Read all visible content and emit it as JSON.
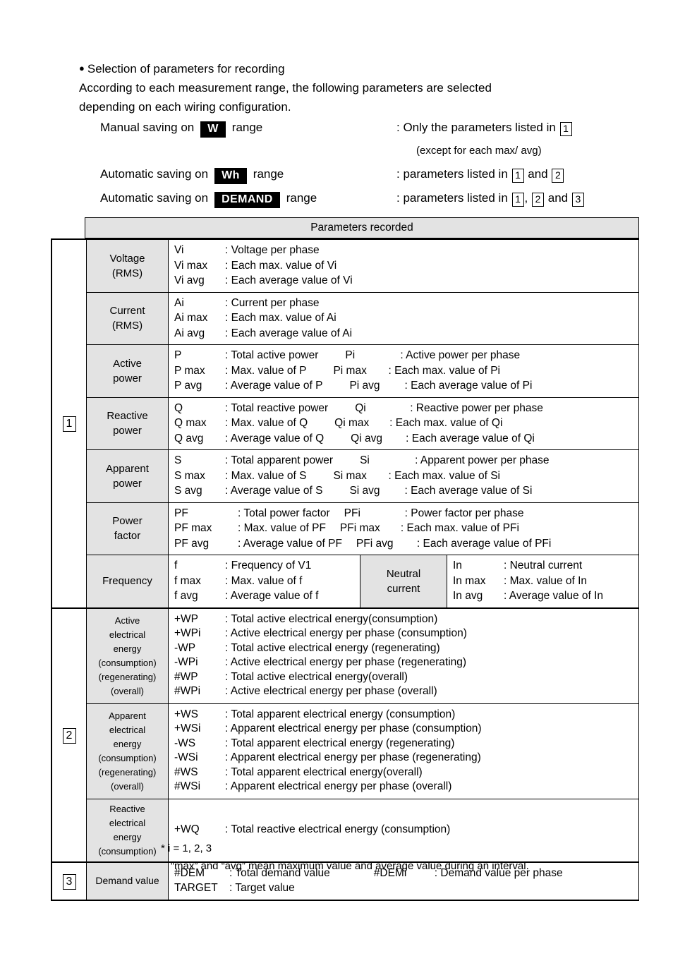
{
  "intro": {
    "bullet": "Selection of parameters for recording",
    "line1": "According to each measurement range, the following parameters are selected",
    "line2": "depending on each wiring configuration.",
    "rows": [
      {
        "lead": "Manual saving on",
        "badge": "W",
        "tail": "range",
        "right_prefix": ": Only the parameters listed in",
        "right_boxes": [
          "1"
        ],
        "sub_note": "(except for each max/ avg)"
      },
      {
        "lead": "Automatic saving on",
        "badge": "Wh",
        "tail": "range",
        "right_prefix": ": parameters listed in",
        "right_boxes": [
          "1",
          "2"
        ],
        "right_joiner": "and"
      },
      {
        "lead": "Automatic saving on",
        "badge": "DEMAND",
        "tail": "range",
        "right_prefix": ": parameters listed in",
        "right_boxes": [
          "1",
          "2",
          "3"
        ],
        "right_joiner": "and"
      }
    ]
  },
  "table": {
    "header": "Parameters recorded",
    "section1": {
      "marker": "1",
      "rows": {
        "voltage": {
          "label_line1": "Voltage",
          "label_line2": "(RMS)",
          "defs": [
            {
              "sym": "Vi",
              "desc": ": Voltage per phase"
            },
            {
              "sym": "Vi max",
              "desc": ": Each max. value of Vi"
            },
            {
              "sym": "Vi avg",
              "desc": ": Each average value of Vi"
            }
          ]
        },
        "current": {
          "label_line1": "Current",
          "label_line2": "(RMS)",
          "defs": [
            {
              "sym": "Ai",
              "desc": ": Current per phase"
            },
            {
              "sym": "Ai max",
              "desc": ": Each max. value of Ai"
            },
            {
              "sym": "Ai avg",
              "desc": ": Each average value of Ai"
            }
          ]
        },
        "active_power": {
          "label_line1": "Active",
          "label_line2": "power",
          "defs": [
            {
              "sym": "P",
              "desc": ": Total active power",
              "sym2": "Pi",
              "desc2": ": Active power per phase"
            },
            {
              "sym": "P max",
              "desc": ": Max. value of P",
              "sym2": "Pi max",
              "desc2": ": Each max. value of Pi"
            },
            {
              "sym": "P avg",
              "desc": ": Average value of P",
              "sym2": "Pi avg",
              "desc2": ": Each average value of Pi"
            }
          ]
        },
        "reactive_power": {
          "label_line1": "Reactive",
          "label_line2": "power",
          "defs": [
            {
              "sym": "Q",
              "desc": ": Total reactive power",
              "sym2": "Qi",
              "desc2": ": Reactive power per phase"
            },
            {
              "sym": "Q max",
              "desc": ": Max. value of Q",
              "sym2": "Qi max",
              "desc2": ": Each max. value of Qi"
            },
            {
              "sym": "Q avg",
              "desc": ": Average value of Q",
              "sym2": "Qi avg",
              "desc2": ": Each average value of Qi"
            }
          ]
        },
        "apparent_power": {
          "label_line1": "Apparent",
          "label_line2": "power",
          "defs": [
            {
              "sym": "S",
              "desc": ": Total apparent power",
              "sym2": "Si",
              "desc2": ": Apparent power per phase"
            },
            {
              "sym": "S max",
              "desc": ": Max. value of S",
              "sym2": "Si max",
              "desc2": ": Each max. value of Si"
            },
            {
              "sym": "S avg",
              "desc": ": Average value of S",
              "sym2": "Si avg",
              "desc2": ": Each average value of Si"
            }
          ]
        },
        "power_factor": {
          "label_line1": "Power",
          "label_line2": "factor",
          "defs": [
            {
              "sym": "PF",
              "desc": ": Total power factor",
              "sym2": "PFi",
              "desc2": ": Power factor per phase"
            },
            {
              "sym": "PF max",
              "desc": ": Max. value of PF",
              "sym2": "PFi max",
              "desc2": ": Each max. value of PFi"
            },
            {
              "sym": "PF avg",
              "desc": ": Average value of PF",
              "sym2": "PFi avg",
              "desc2": ": Each average value of PFi"
            }
          ]
        },
        "frequency": {
          "label": "Frequency",
          "defs": [
            {
              "sym": "f",
              "desc": ": Frequency of V1"
            },
            {
              "sym": "f max",
              "desc": ": Max. value of f"
            },
            {
              "sym": "f avg",
              "desc": ": Average value of f"
            }
          ],
          "neutral_label_line1": "Neutral",
          "neutral_label_line2": "current",
          "neutral_defs": [
            {
              "sym": "In",
              "desc": ": Neutral current"
            },
            {
              "sym": "In max",
              "desc": ": Max. value of In"
            },
            {
              "sym": "In avg",
              "desc": ": Average value of In"
            }
          ]
        }
      }
    },
    "section2": {
      "marker": "2",
      "rows": {
        "active_energy": {
          "label_lines": [
            "Active",
            "electrical",
            "energy",
            "(consumption)",
            "(regenerating)",
            "(overall)"
          ],
          "defs": [
            {
              "sym": "+WP",
              "desc": ": Total active electrical energy(consumption)"
            },
            {
              "sym": "+WPi",
              "desc": ": Active electrical energy per phase (consumption)"
            },
            {
              "sym": "-WP",
              "desc": ": Total active electrical energy (regenerating)"
            },
            {
              "sym": "-WPi",
              "desc": ": Active electrical energy per phase (regenerating)"
            },
            {
              "sym": "#WP",
              "desc": ": Total active electrical energy(overall)"
            },
            {
              "sym": "#WPi",
              "desc": ": Active electrical energy per phase (overall)"
            }
          ]
        },
        "apparent_energy": {
          "label_lines": [
            "Apparent",
            "electrical",
            "energy",
            "(consumption)",
            "(regenerating)",
            "(overall)"
          ],
          "defs": [
            {
              "sym": "+WS",
              "desc": ": Total apparent electrical energy (consumption)"
            },
            {
              "sym": "+WSi",
              "desc": ": Apparent electrical energy per phase (consumption)"
            },
            {
              "sym": "-WS",
              "desc": ": Total apparent electrical energy (regenerating)"
            },
            {
              "sym": "-WSi",
              "desc": ": Apparent electrical energy per phase (regenerating)"
            },
            {
              "sym": "#WS",
              "desc": ": Total apparent electrical energy(overall)"
            },
            {
              "sym": "#WSi",
              "desc": ": Apparent electrical energy per phase (overall)"
            }
          ]
        },
        "reactive_energy": {
          "label_lines": [
            "Reactive",
            "electrical",
            "energy",
            "(consumption)"
          ],
          "defs": [
            {
              "sym": "+WQ",
              "desc": ": Total reactive electrical energy (consumption)"
            }
          ]
        }
      }
    },
    "section3": {
      "marker": "3",
      "rows": {
        "demand": {
          "label": "Demand value",
          "defs": [
            {
              "sym": "#DEM",
              "desc": ": Total demand value",
              "sym2": "#DEMi",
              "desc2": ": Demand value per phase"
            },
            {
              "sym": "TARGET",
              "desc": ": Target value"
            }
          ]
        }
      }
    }
  },
  "footnotes": {
    "line1": "* i = 1, 2, 3",
    "line2": "“max” and “avg” mean maximum value and average value during an interval."
  }
}
